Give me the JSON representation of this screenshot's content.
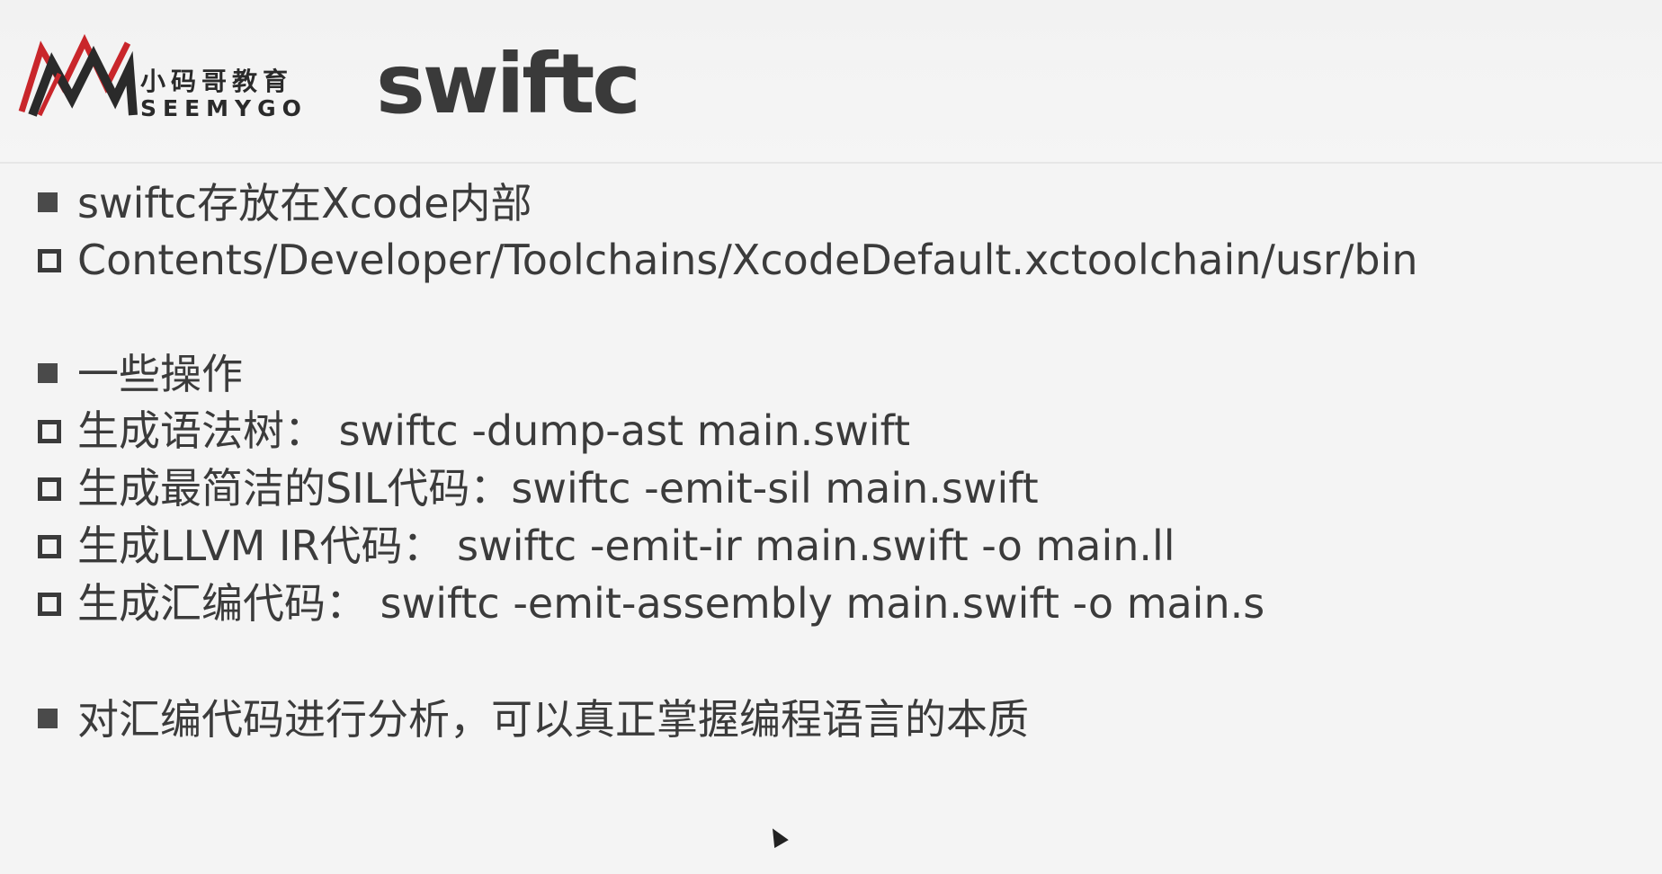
{
  "header": {
    "logo": {
      "chinese_name": "小码哥教育",
      "english_name": "SEEMYGO"
    },
    "title": "swiftc"
  },
  "bullets": [
    {
      "marker": "filled",
      "text": "swiftc存放在Xcode内部"
    },
    {
      "marker": "hollow",
      "text": "Contents/Developer/Toolchains/XcodeDefault.xctoolchain/usr/bin"
    },
    {
      "marker": "filled",
      "text": "一些操作"
    },
    {
      "marker": "hollow",
      "text": "生成语法树： swiftc -dump-ast main.swift"
    },
    {
      "marker": "hollow",
      "text": "生成最简洁的SIL代码：swiftc -emit-sil main.swift"
    },
    {
      "marker": "hollow",
      "text": "生成LLVM IR代码： swiftc -emit-ir main.swift -o main.ll"
    },
    {
      "marker": "hollow",
      "text": "生成汇编代码： swiftc -emit-assembly main.swift -o main.s"
    },
    {
      "marker": "filled",
      "text": "对汇编代码进行分析，可以真正掌握编程语言的本质"
    }
  ],
  "colors": {
    "logo_red": "#c9262b",
    "logo_black": "#2a2a2a",
    "text": "#3b3b3b",
    "background": "#f4f4f4"
  }
}
